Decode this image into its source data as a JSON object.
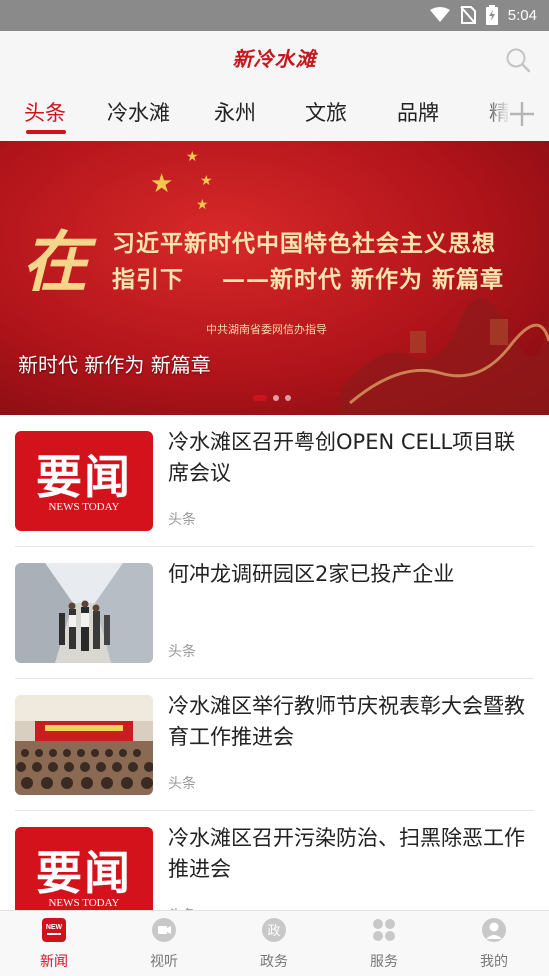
{
  "status_bar": {
    "time": "5:04"
  },
  "header": {
    "logo": "新冷水滩",
    "search_icon": "search-icon"
  },
  "tabs": [
    {
      "label": "头条",
      "active": true
    },
    {
      "label": "冷水滩"
    },
    {
      "label": "永州"
    },
    {
      "label": "文旅"
    },
    {
      "label": "品牌"
    },
    {
      "label": "精"
    }
  ],
  "banner": {
    "big_char": "在",
    "line1": "习近平新时代中国特色社会主义思想",
    "line2a": "指引下",
    "line2b": "——新时代 新作为 新篇章",
    "guide": "中共湖南省委网信办指导",
    "caption": "新时代 新作为 新篇章",
    "slides": 3,
    "active_slide": 1
  },
  "thumb_news_today": {
    "big": "要闻",
    "small": "NEWS TODAY"
  },
  "news": [
    {
      "title": "冷水滩区召开粤创OPEN CELL项目联席会议",
      "tag": "头条",
      "thumb": "news-today"
    },
    {
      "title": "何冲龙调研园区2家已投产企业",
      "tag": "头条",
      "thumb": "corridor-photo"
    },
    {
      "title": "冷水滩区举行教师节庆祝表彰大会暨教育工作推进会",
      "tag": "头条",
      "thumb": "auditorium-photo"
    },
    {
      "title": "冷水滩区召开污染防治、扫黑除恶工作推进会",
      "tag": "头条",
      "thumb": "news-today"
    }
  ],
  "bottom_nav": [
    {
      "label": "新闻",
      "icon": "news-icon",
      "active": true
    },
    {
      "label": "视听",
      "icon": "video-icon"
    },
    {
      "label": "政务",
      "icon": "government-icon",
      "glyph": "政"
    },
    {
      "label": "服务",
      "icon": "services-icon"
    },
    {
      "label": "我的",
      "icon": "profile-icon"
    }
  ],
  "colors": {
    "brand_red": "#d1121c",
    "status_bar": "#8a8a8a"
  },
  "new_badge": "NEW"
}
